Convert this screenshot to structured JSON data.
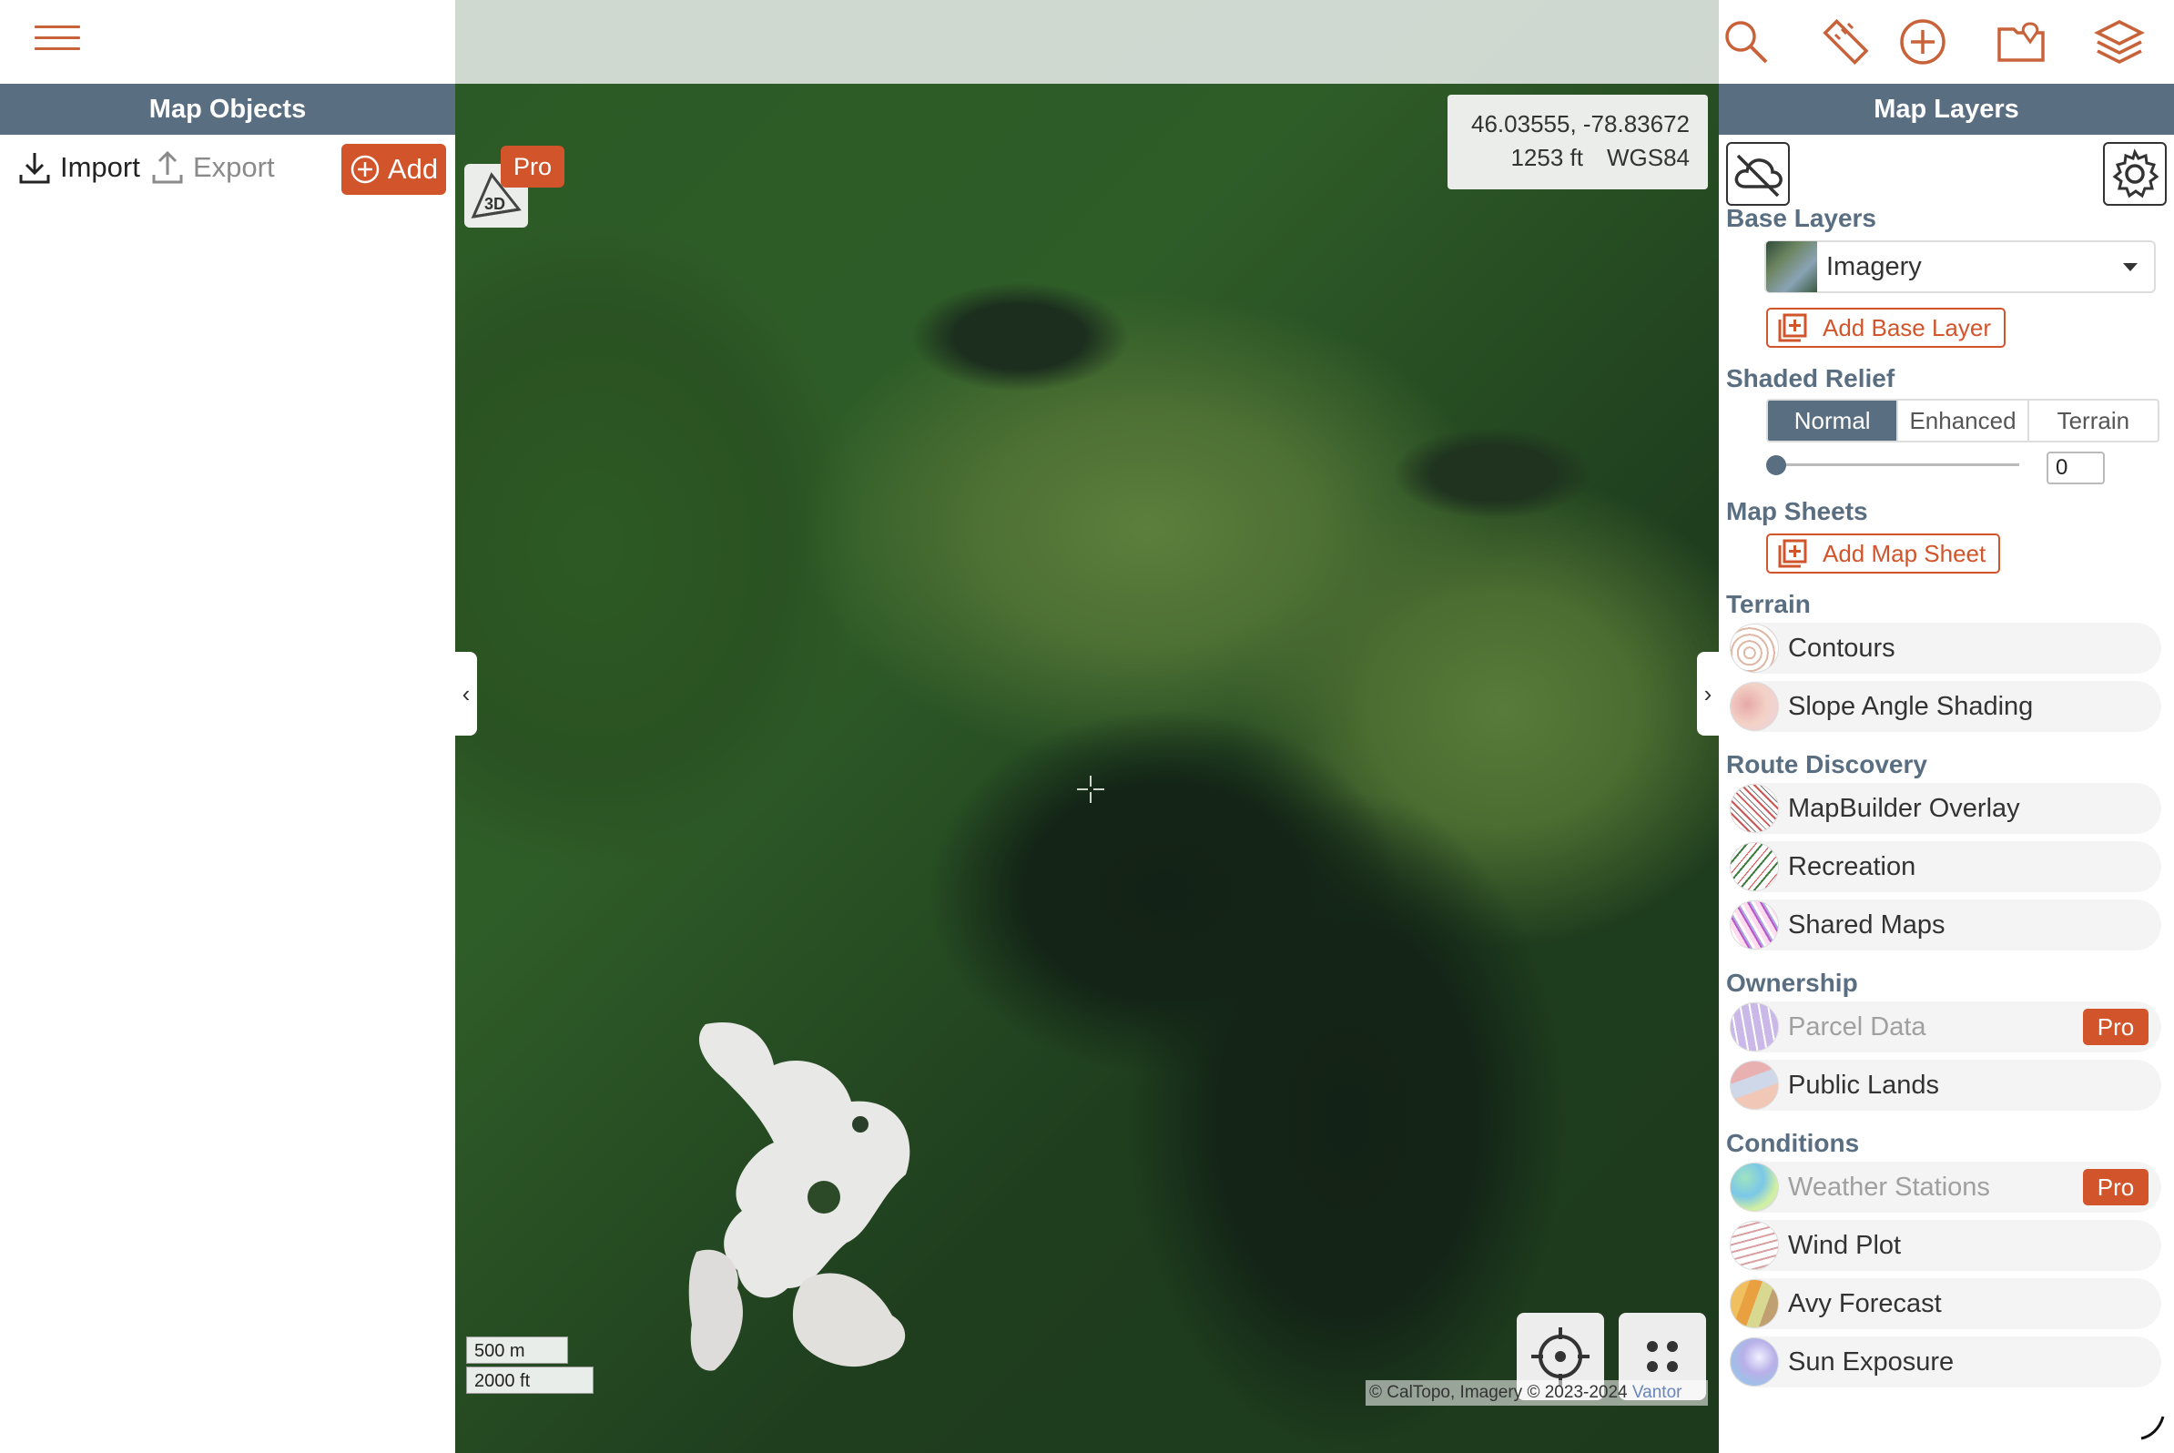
{
  "left_panel": {
    "header": "Map Objects",
    "import_label": "Import",
    "export_label": "Export",
    "add_label": "Add"
  },
  "map": {
    "coords": "46.03555, -78.83672",
    "elevation": "1253 ft",
    "datum": "WGS84",
    "pro_badge": "Pro",
    "scale_metric": "500 m",
    "scale_imperial": "2000 ft",
    "attribution": "© CalTopo, Imagery © 2023-2024 ",
    "attribution_link": "Vantor"
  },
  "right_panel": {
    "header": "Map Layers",
    "base_layers": {
      "label": "Base Layers",
      "selected": "Imagery",
      "add_label": "Add Base Layer"
    },
    "shaded_relief": {
      "label": "Shaded Relief",
      "options": [
        "Normal",
        "Enhanced",
        "Terrain"
      ],
      "active": "Normal",
      "value": "0"
    },
    "map_sheets": {
      "label": "Map Sheets",
      "add_label": "Add Map Sheet"
    },
    "terrain": {
      "label": "Terrain",
      "items": [
        {
          "label": "Contours",
          "pro": false
        },
        {
          "label": "Slope Angle Shading",
          "pro": false
        }
      ]
    },
    "route_discovery": {
      "label": "Route Discovery",
      "items": [
        {
          "label": "MapBuilder Overlay"
        },
        {
          "label": "Recreation"
        },
        {
          "label": "Shared Maps"
        }
      ]
    },
    "ownership": {
      "label": "Ownership",
      "items": [
        {
          "label": "Parcel Data",
          "pro": "Pro"
        },
        {
          "label": "Public Lands"
        }
      ]
    },
    "conditions": {
      "label": "Conditions",
      "items": [
        {
          "label": "Weather Stations",
          "pro": "Pro"
        },
        {
          "label": "Wind Plot"
        },
        {
          "label": "Avy Forecast"
        },
        {
          "label": "Sun Exposure"
        }
      ]
    }
  },
  "colors": {
    "accent": "#d2542b",
    "header_bg": "#5a6e82"
  }
}
